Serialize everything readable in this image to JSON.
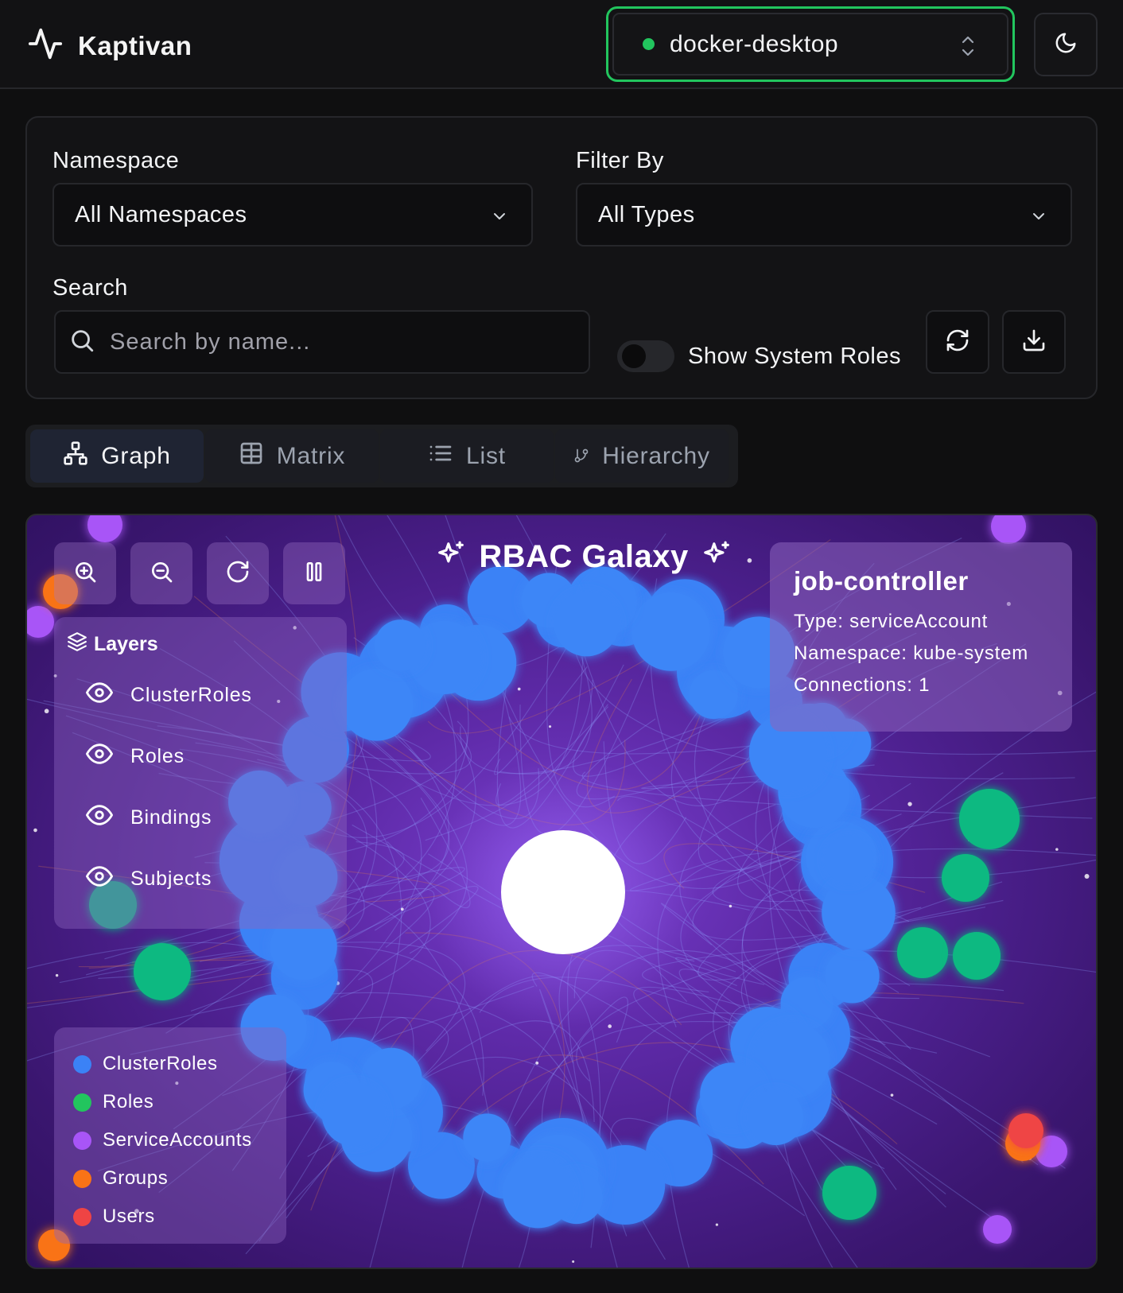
{
  "app": {
    "name": "Kaptivan"
  },
  "context": {
    "name": "docker-desktop",
    "status_color": "#22c55e"
  },
  "filters": {
    "namespace_label": "Namespace",
    "namespace_value": "All Namespaces",
    "filter_by_label": "Filter By",
    "filter_by_value": "All Types",
    "search_label": "Search",
    "search_placeholder": "Search by name...",
    "show_system_roles_label": "Show System Roles",
    "show_system_roles": false
  },
  "tabs": [
    {
      "label": "Graph",
      "icon": "network-icon",
      "active": true
    },
    {
      "label": "Matrix",
      "icon": "table-icon",
      "active": false
    },
    {
      "label": "List",
      "icon": "list-icon",
      "active": false
    },
    {
      "label": "Hierarchy",
      "icon": "git-branch-icon",
      "active": false
    }
  ],
  "galaxy": {
    "title": "RBAC Galaxy",
    "controls": [
      "zoom-in-icon",
      "zoom-out-icon",
      "reset-icon",
      "pause-icon"
    ],
    "layers_title": "Layers",
    "layers": [
      {
        "label": "ClusterRoles",
        "visible": true
      },
      {
        "label": "Roles",
        "visible": true
      },
      {
        "label": "Bindings",
        "visible": true
      },
      {
        "label": "Subjects",
        "visible": true
      }
    ],
    "selected": {
      "name": "job-controller",
      "type_line": "Type: serviceAccount",
      "namespace_line": "Namespace: kube-system",
      "connections_line": "Connections: 1"
    },
    "legend": [
      {
        "label": "ClusterRoles",
        "color": "#3b82f6"
      },
      {
        "label": "Roles",
        "color": "#22c55e"
      },
      {
        "label": "ServiceAccounts",
        "color": "#a855f7"
      },
      {
        "label": "Groups",
        "color": "#f97316"
      },
      {
        "label": "Users",
        "color": "#ef4444"
      }
    ]
  }
}
